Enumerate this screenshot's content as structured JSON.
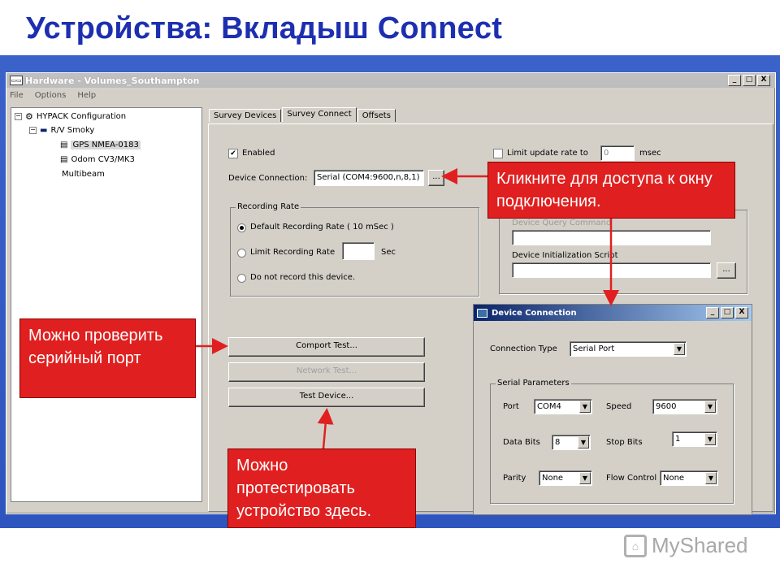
{
  "slide": {
    "title": "Устройства:  Вкладыш Connect"
  },
  "window": {
    "title": "Hardware - Volumes_Southampton",
    "icon_text": "▭▭",
    "buttons": [
      "_",
      "□",
      "X"
    ],
    "menu": [
      "File",
      "Options",
      "Help"
    ]
  },
  "tree": {
    "items": [
      {
        "toggle": "−",
        "label": "HYPACK Configuration"
      },
      {
        "toggle": "−",
        "label": "R/V Smoky"
      },
      {
        "label": "GPS NMEA-0183"
      },
      {
        "label": "Odom CV3/MK3"
      },
      {
        "label": "Multibeam"
      }
    ]
  },
  "tabs": [
    "Survey Devices",
    "Survey Connect",
    "Offsets"
  ],
  "connect": {
    "enabled_label": "Enabled",
    "enabled_mark": "✔",
    "limit_label": "Limit update rate to",
    "limit_value": "0",
    "limit_unit": "msec",
    "device_connection_label": "Device Connection:",
    "device_connection_value": "Serial (COM4:9600,n,8,1)",
    "browse_label": "...",
    "recording_rate": {
      "title": "Recording Rate",
      "options": [
        "Default Recording Rate ( 10 mSec )",
        "Limit Recording Rate",
        "Do not record this device."
      ],
      "unit": "Sec"
    },
    "query_label": "Device Query Command",
    "init_label": "Device Initialization Script",
    "init_browse": "...",
    "buttons": {
      "comport": "Comport Test...",
      "network": "Network Test...",
      "test": "Test Device..."
    }
  },
  "dialog": {
    "title": "Device Connection",
    "buttons": [
      "_",
      "□",
      "X"
    ],
    "connection_type_label": "Connection Type",
    "connection_type_value": "Serial Port",
    "serial_group": "Serial Parameters",
    "port_label": "Port",
    "port_value": "COM4",
    "speed_label": "Speed",
    "speed_value": "9600",
    "databits_label": "Data Bits",
    "databits_value": "8",
    "stopbits_label": "Stop Bits",
    "stopbits_value": "1",
    "parity_label": "Parity",
    "parity_value": "None",
    "flow_label": "Flow Control",
    "flow_value": "None",
    "arrow": "▼"
  },
  "callouts": {
    "access": "Кликните для доступа к окну подключения.",
    "check_port": "Можно проверить серийный порт",
    "test_device": "Можно протестировать устройство здесь."
  },
  "logo": {
    "text": "MyShared"
  },
  "colors": {
    "title": "#1d2fb0",
    "callout": "#e02020",
    "band": "#3b62c9"
  }
}
